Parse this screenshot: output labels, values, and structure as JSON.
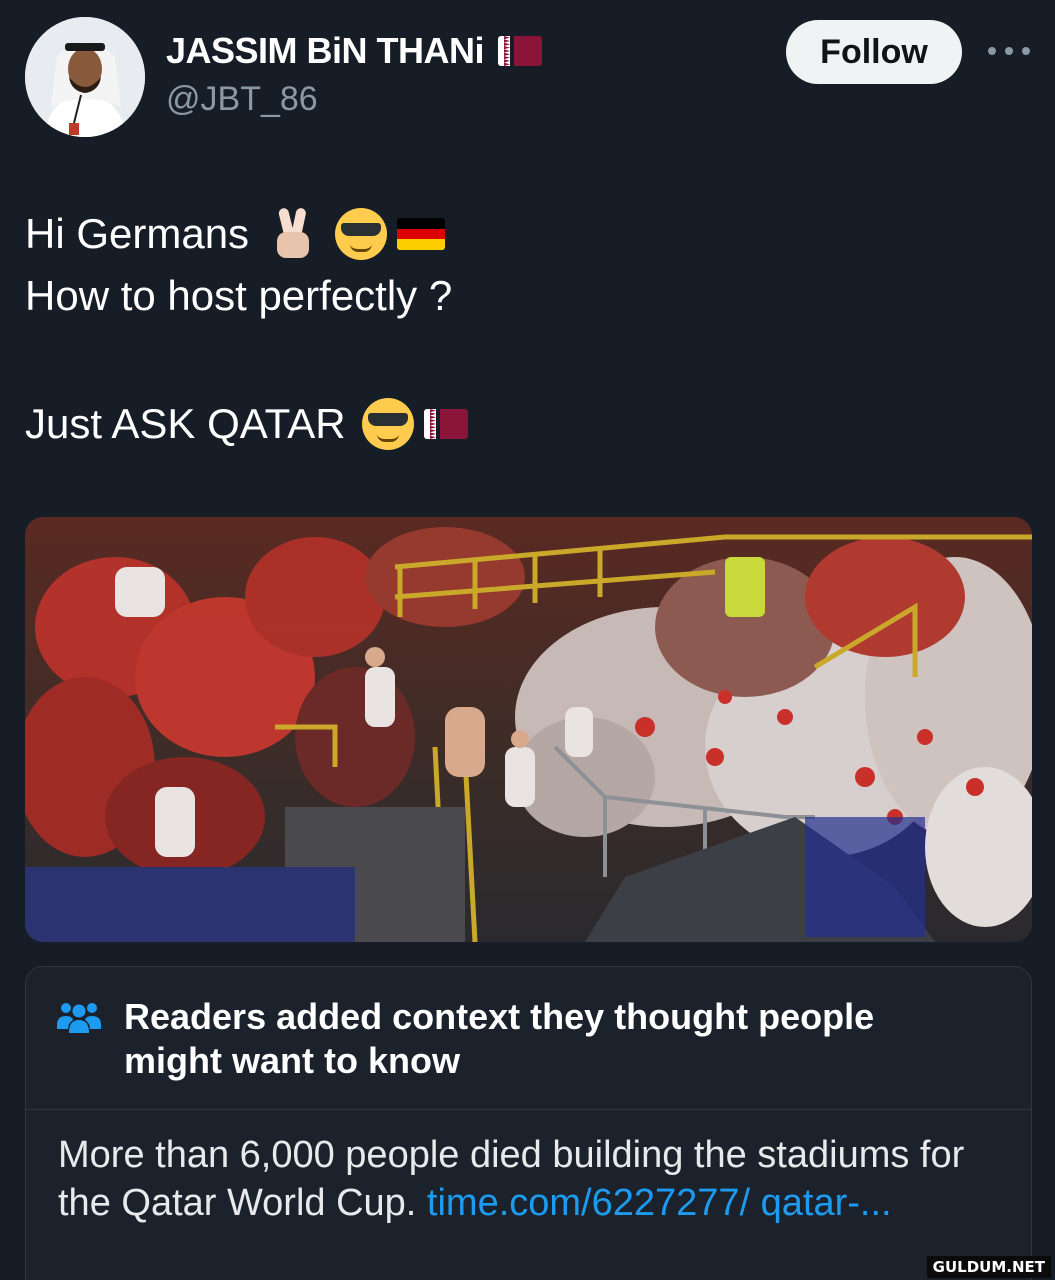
{
  "user": {
    "display_name": "JASSIM BiN THANi",
    "handle": "@JBT_86",
    "flag_icon": "qatar-flag-icon",
    "avatar_icon": "profile-avatar"
  },
  "actions": {
    "follow_label": "Follow",
    "more_icon": "more-options-icon"
  },
  "tweet": {
    "line1": "Hi Germans",
    "line2": "How to host perfectly ?",
    "line3": "Just ASK QATAR",
    "line1_emojis": [
      "victory-hand-icon",
      "sunglasses-face-icon",
      "germany-flag-icon"
    ],
    "line3_emojis": [
      "sunglasses-face-icon",
      "qatar-flag-icon"
    ]
  },
  "media": {
    "icon": "stadium-fans-photo"
  },
  "community_note": {
    "icon": "people-group-icon",
    "title": "Readers added context they thought people might want to know",
    "body": "More than 6,000 people died building the stadiums for the Qatar World Cup.",
    "link": "time.com/6227277/ qatar-..."
  },
  "watermark": "GULDUM.NET",
  "colors": {
    "background": "#171d27",
    "link": "#1d9bf0",
    "follow_bg": "#eff3f4",
    "muted": "#8b98a5"
  }
}
